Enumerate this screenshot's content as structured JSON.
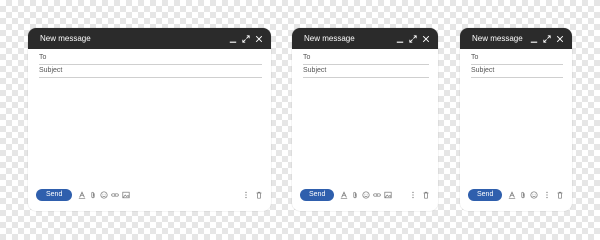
{
  "colors": {
    "titlebar": "#2b2b2b",
    "send_button": "#2f5fad",
    "window_bg": "#ffffff",
    "checker": "#e6e6e6"
  },
  "windows": [
    {
      "title": "New message",
      "to_label": "To",
      "subject_label": "Subject",
      "send_label": "Send",
      "title_icons": [
        "minimize-icon",
        "expand-icon",
        "close-icon"
      ],
      "toolbar_icons": [
        "font-format-icon",
        "attachment-icon",
        "emoji-icon",
        "link-icon",
        "image-icon"
      ],
      "footer_icons": [
        "more-options-icon",
        "trash-icon"
      ]
    },
    {
      "title": "New message",
      "to_label": "To",
      "subject_label": "Subject",
      "send_label": "Send",
      "title_icons": [
        "minimize-icon",
        "expand-icon",
        "close-icon"
      ],
      "toolbar_icons": [
        "font-format-icon",
        "attachment-icon",
        "emoji-icon",
        "link-icon",
        "image-icon"
      ],
      "footer_icons": [
        "more-options-icon",
        "trash-icon"
      ]
    },
    {
      "title": "New message",
      "to_label": "To",
      "subject_label": "Subject",
      "send_label": "Send",
      "title_icons": [
        "minimize-icon",
        "expand-icon",
        "close-icon"
      ],
      "toolbar_icons": [
        "font-format-icon",
        "attachment-icon",
        "emoji-icon"
      ],
      "footer_icons": [
        "more-options-icon",
        "trash-icon"
      ]
    }
  ]
}
